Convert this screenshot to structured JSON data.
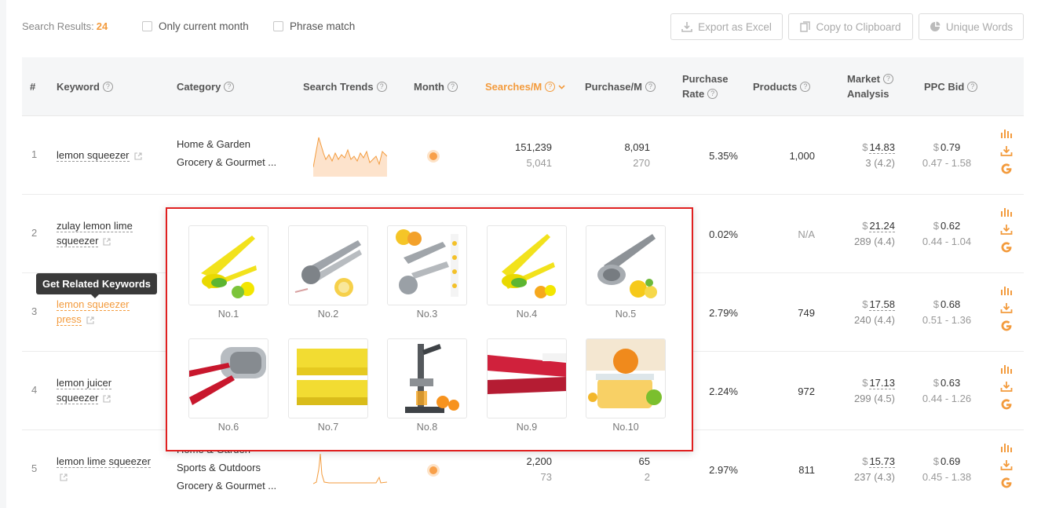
{
  "toolbar": {
    "results_label": "Search Results:",
    "results_count": "24",
    "only_current_month": "Only current month",
    "phrase_match": "Phrase match",
    "export_label": "Export as Excel",
    "copy_label": "Copy to Clipboard",
    "unique_label": "Unique Words"
  },
  "columns": {
    "idx": "#",
    "keyword": "Keyword",
    "category": "Category",
    "trends": "Search Trends",
    "month": "Month",
    "searches": "Searches/M",
    "purchase": "Purchase/M",
    "rate_1": "Purchase",
    "rate_2": "Rate",
    "products": "Products",
    "market_1": "Market",
    "market_2": "Analysis",
    "ppc": "PPC Bid"
  },
  "rows": [
    {
      "idx": "1",
      "kw1": "lemon squeezer",
      "kw2": "",
      "cat1": "Home & Garden",
      "cat2": "Grocery & Gourmet ...",
      "cat3": "",
      "searches": "151,239",
      "searches_sub": "5,041",
      "purchase": "8,091",
      "purchase_sub": "270",
      "rate": "5.35%",
      "products": "1,000",
      "ma_price": "14.83",
      "ma_sub": "3 (4.2)",
      "ppc": "0.79",
      "ppc_range": "0.47 - 1.58"
    },
    {
      "idx": "2",
      "kw1": "zulay lemon lime",
      "kw2": "squeezer",
      "rate": "0.02%",
      "products": "N/A",
      "ma_price": "21.24",
      "ma_sub": "289 (4.4)",
      "ppc": "0.62",
      "ppc_range": "0.44 - 1.04"
    },
    {
      "idx": "3",
      "kw1": "lemon squeezer",
      "kw2": "press",
      "rate": "2.79%",
      "products": "749",
      "ma_price": "17.58",
      "ma_sub": "240 (4.4)",
      "ppc": "0.68",
      "ppc_range": "0.51 - 1.36"
    },
    {
      "idx": "4",
      "kw1": "lemon juicer",
      "kw2": "squeezer",
      "rate": "2.24%",
      "products": "972",
      "ma_price": "17.13",
      "ma_sub": "299 (4.5)",
      "ppc": "0.63",
      "ppc_range": "0.44 - 1.26"
    },
    {
      "idx": "5",
      "kw1": "lemon lime squeezer",
      "kw2": "",
      "cat1": "Home & Garden",
      "cat2": "Sports & Outdoors",
      "cat3": "Grocery & Gourmet ...",
      "searches": "2,200",
      "searches_sub": "73",
      "purchase": "65",
      "purchase_sub": "2",
      "rate": "2.97%",
      "products": "811",
      "ma_price": "15.73",
      "ma_sub": "237 (4.3)",
      "ppc": "0.69",
      "ppc_range": "0.45 - 1.38"
    }
  ],
  "currency": "$",
  "tooltip": "Get Related Keywords",
  "products_popup": {
    "labels": [
      "No.1",
      "No.2",
      "No.3",
      "No.4",
      "No.5",
      "No.6",
      "No.7",
      "No.8",
      "No.9",
      "No.10"
    ]
  },
  "colors": {
    "accent": "#f39b3d",
    "popup_border": "#e02020",
    "header_bg": "#f5f6f7"
  },
  "icons": [
    "export-icon",
    "copy-icon",
    "pie-chart-icon",
    "bar-chart-icon",
    "download-icon",
    "google-icon",
    "external-link-icon",
    "help-icon",
    "sort-desc-icon"
  ]
}
